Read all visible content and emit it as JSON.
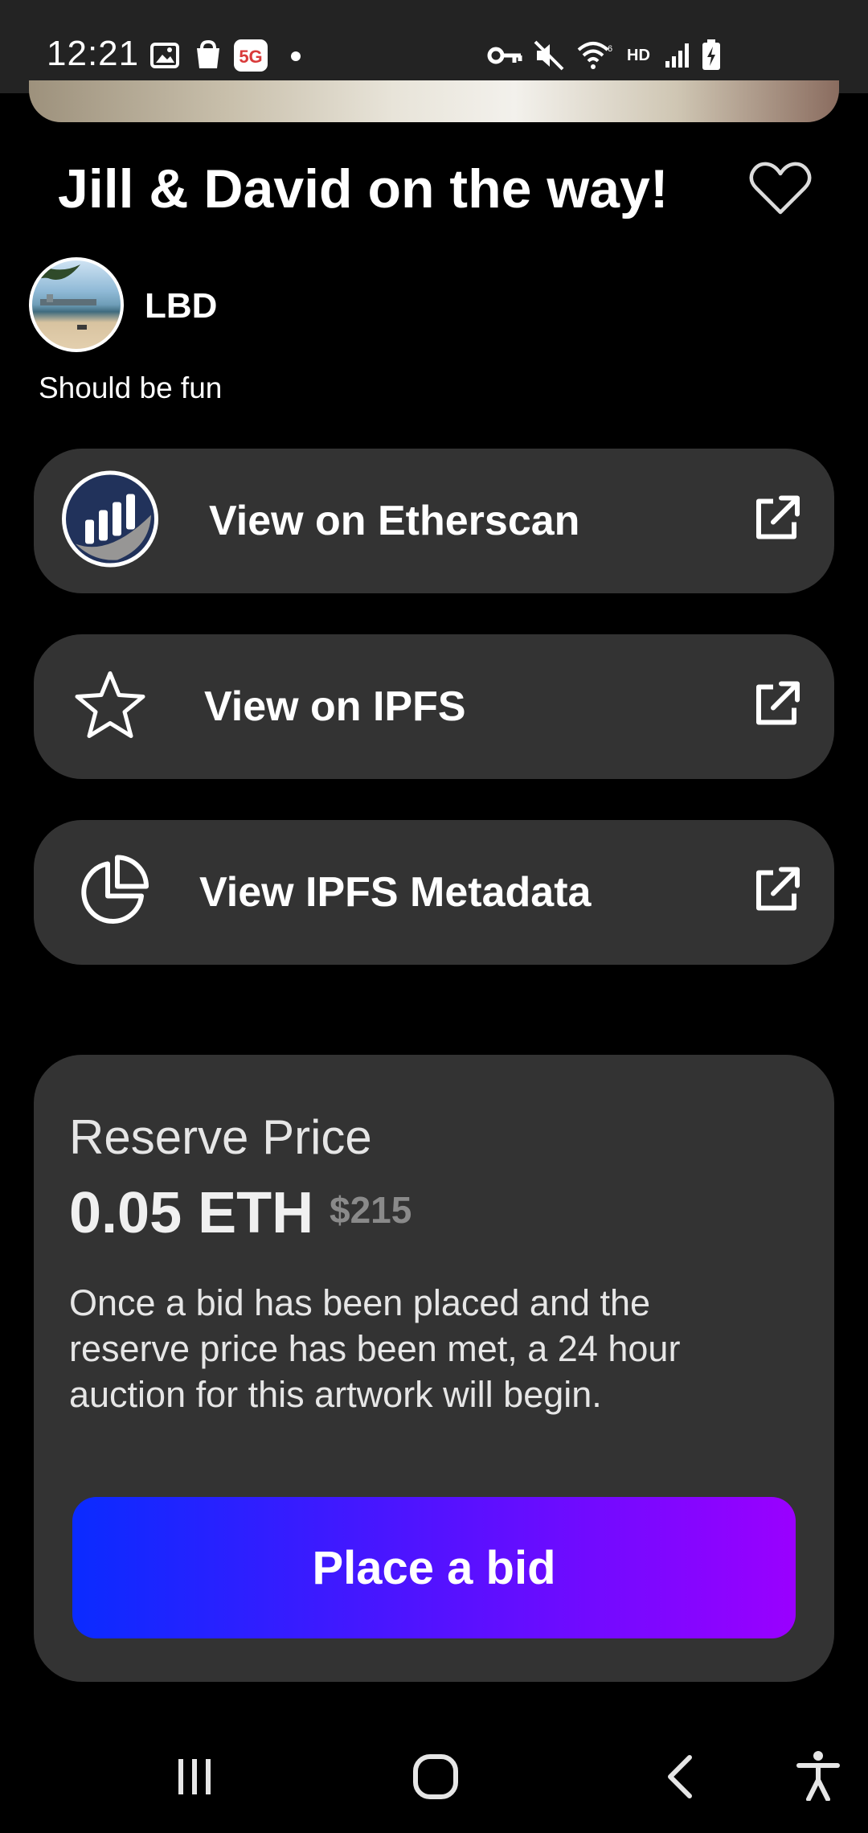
{
  "status_bar": {
    "time": "12:21",
    "left_icons": [
      "gallery-icon",
      "shopping-bag-icon",
      "5g-app-icon",
      "dot-icon"
    ],
    "right_icons": [
      "vpn-key-icon",
      "mute-icon",
      "wifi-icon",
      "hd-icon",
      "signal-icon",
      "battery-charging-icon"
    ],
    "hd_label": "HD"
  },
  "title": "Jill & David on the way!",
  "creator": {
    "name": "LBD"
  },
  "description": "Should be fun",
  "links": [
    {
      "label": "View on Etherscan",
      "icon": "etherscan-logo-icon"
    },
    {
      "label": "View on IPFS",
      "icon": "star-icon"
    },
    {
      "label": "View IPFS Metadata",
      "icon": "pie-chart-icon"
    }
  ],
  "reserve": {
    "label": "Reserve Price",
    "value": "0.05 ETH",
    "usd": "$215",
    "description": "Once a bid has been placed and the reserve price has been met, a 24 hour auction for this artwork will begin."
  },
  "bid_button": {
    "label": "Place a bid"
  },
  "colors": {
    "card": "#333333",
    "gradient_start": "#0a2bff",
    "gradient_end": "#9a00ff"
  }
}
